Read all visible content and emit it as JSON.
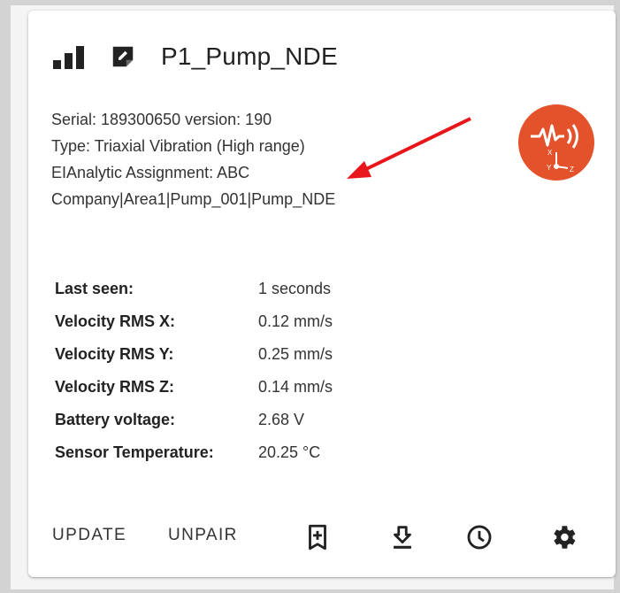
{
  "device": {
    "name": "P1_Pump_NDE",
    "signal_icon": "signal-bars-icon",
    "note_icon": "edit-note-icon"
  },
  "info": {
    "serial_line": "Serial: 189300650 version: 190",
    "type_line": "Type: Triaxial Vibration (High range)",
    "assignment_line": "EIAnalytic Assignment: ABC",
    "path_line": "Company|Area1|Pump_001|Pump_NDE"
  },
  "badge": {
    "icon": "triaxial-vibration-sensor-icon",
    "color": "#e4522b",
    "axis_x": "X",
    "axis_y": "Y",
    "axis_z": "Z"
  },
  "annotation": {
    "arrow_color": "#e8161b"
  },
  "stats": [
    {
      "label": "Last seen:",
      "value": "1 seconds"
    },
    {
      "label": "Velocity RMS X:",
      "value": "0.12 mm/s"
    },
    {
      "label": "Velocity RMS Y:",
      "value": "0.25 mm/s"
    },
    {
      "label": "Velocity RMS Z:",
      "value": "0.14 mm/s"
    },
    {
      "label": "Battery voltage:",
      "value": "2.68 V"
    },
    {
      "label": "Sensor Temperature:",
      "value": "20.25 °C"
    }
  ],
  "actions": {
    "update_label": "UPDATE",
    "unpair_label": "UNPAIR",
    "icons": [
      "bookmark-add-icon",
      "download-icon",
      "history-clock-icon",
      "settings-gear-icon"
    ]
  }
}
